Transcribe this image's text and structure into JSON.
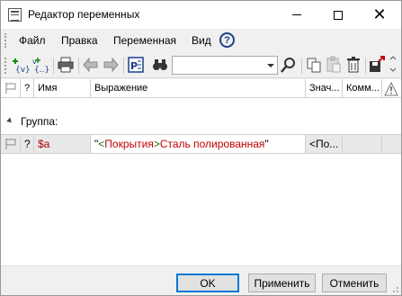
{
  "window": {
    "title": "Редактор переменных",
    "close_glyph": "✕"
  },
  "menu": {
    "items": [
      "Файл",
      "Правка",
      "Переменная",
      "Вид"
    ],
    "help_glyph": "?"
  },
  "toolbar": {
    "search": {
      "value": "",
      "placeholder": ""
    },
    "icons": [
      "add-variable-icon",
      "insert-variable-icon",
      "print-icon",
      "undo-icon",
      "redo-icon",
      "property-editor-icon",
      "find-icon",
      "search-icon",
      "copy-icon",
      "paste-icon",
      "delete-icon",
      "export-icon"
    ]
  },
  "table": {
    "columns": [
      "?",
      "Имя",
      "Выражение",
      "Знач...",
      "Комм..."
    ],
    "group": {
      "label": "Группа:"
    },
    "rows": [
      {
        "flag": "",
        "q": "?",
        "name": "$a",
        "expr_quote_open": "\"",
        "expr_lt1": "<",
        "expr_part1": "Покрытия",
        "expr_gt1": ">",
        "expr_part2": "Сталь полированная",
        "expr_quote_close": "\"",
        "value": "<По...",
        "comment": ""
      }
    ]
  },
  "footer": {
    "ok": "OK",
    "apply": "Применить",
    "cancel": "Отменить"
  },
  "colors": {
    "accent": "#0078d7",
    "var_name": "#b00000",
    "expr_text": "#c00000",
    "bracket": "#0a6e0a"
  }
}
